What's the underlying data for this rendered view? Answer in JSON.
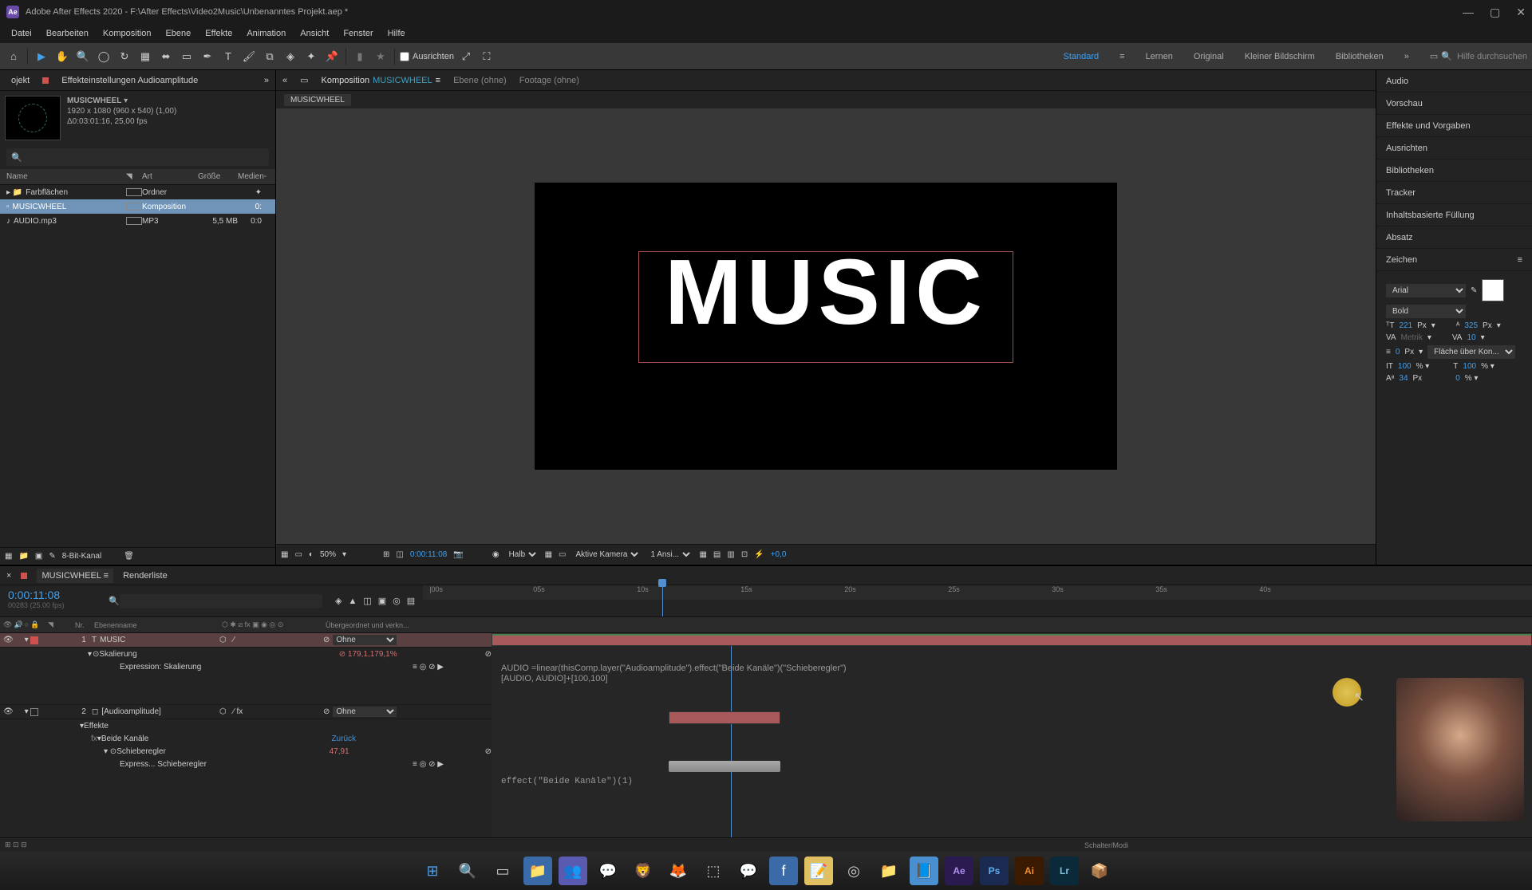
{
  "titlebar": {
    "app": "Adobe After Effects 2020",
    "path": "F:\\After Effects\\Video2Music\\Unbenanntes Projekt.aep *"
  },
  "menu": [
    "Datei",
    "Bearbeiten",
    "Komposition",
    "Ebene",
    "Effekte",
    "Animation",
    "Ansicht",
    "Fenster",
    "Hilfe"
  ],
  "toolbar": {
    "align": "Ausrichten"
  },
  "workspaces": {
    "active": "Standard",
    "items": [
      "Standard",
      "Lernen",
      "Original",
      "Kleiner Bildschirm",
      "Bibliotheken"
    ]
  },
  "search": {
    "placeholder": "Hilfe durchsuchen"
  },
  "project_panel": {
    "tab_project": "ojekt",
    "tab_effect": "Effekteinstellungen Audioamplitude",
    "comp_name": "MUSICWHEEL",
    "dims": "1920 x 1080 (960 x 540) (1,00)",
    "dur": "Δ0:03:01:16, 25,00 fps",
    "cols": {
      "name": "Name",
      "art": "Art",
      "size": "Größe",
      "med": "Medien-"
    },
    "rows": [
      {
        "name": "Farbflächen",
        "art": "Ordner",
        "size": "",
        "med": ""
      },
      {
        "name": "MUSICWHEEL",
        "art": "Komposition",
        "size": "",
        "med": "0:"
      },
      {
        "name": "AUDIO.mp3",
        "art": "MP3",
        "size": "5,5 MB",
        "med": "0:0"
      }
    ],
    "footer": "8-Bit-Kanal"
  },
  "comp_panel": {
    "tab_comp": "Komposition",
    "comp_link": "MUSICWHEEL",
    "tab_layer": "Ebene (ohne)",
    "tab_footage": "Footage (ohne)",
    "crumb": "MUSICWHEEL",
    "preview_text": "MUSIC",
    "footer": {
      "zoom": "50%",
      "time": "0:00:11:08",
      "res": "Halb",
      "camera": "Aktive Kamera",
      "views": "1 Ansi...",
      "exp": "+0,0"
    }
  },
  "right_panels": [
    "Audio",
    "Vorschau",
    "Effekte und Vorgaben",
    "Ausrichten",
    "Bibliotheken",
    "Tracker",
    "Inhaltsbasierte Füllung",
    "Absatz",
    "Zeichen"
  ],
  "char": {
    "font": "Arial",
    "style": "Bold",
    "size": "221",
    "units": "Px",
    "lead": "325",
    "kern": "Metrik",
    "track": "10",
    "baseline": "0",
    "strokeopt": "Fläche über Kon...",
    "h": "100",
    "v": "100",
    "s1": "34",
    "s2": "0"
  },
  "timeline": {
    "tab": "MUSICWHEEL",
    "render": "Renderliste",
    "time": "0:00:11:08",
    "frames": "00283 (25.00 fps)",
    "cols": {
      "nr": "Nr.",
      "ename": "Ebenenname",
      "parent": "Übergeordnet und verkn..."
    },
    "marks": [
      "|00s",
      "05s",
      "10s",
      "15s",
      "20s",
      "25s",
      "30s",
      "35s",
      "40s"
    ],
    "layer1": {
      "num": "1",
      "name": "MUSIC",
      "prop": "Skalierung",
      "val": "179,1,179,1%",
      "exprlabel": "Expression: Skalierung",
      "parent": "Ohne"
    },
    "layer2": {
      "num": "2",
      "name": "[Audioamplitude]",
      "parent": "Ohne",
      "fx": "Effekte",
      "ch": "Beide Kanäle",
      "reset": "Zurück",
      "slider": "Schieberegler",
      "sval": "47,91",
      "exprlabel": "Express... Schieberegler"
    },
    "expr1": "AUDIO =linear(thisComp.layer(\"Audioamplitude\").effect(\"Beide Kanäle\")(\"Schieberegler\")",
    "expr1b": "[AUDIO, AUDIO]+[100,100]",
    "expr2": "effect(\"Beide Kanäle\")(1)",
    "footer": "Schalter/Modi"
  }
}
